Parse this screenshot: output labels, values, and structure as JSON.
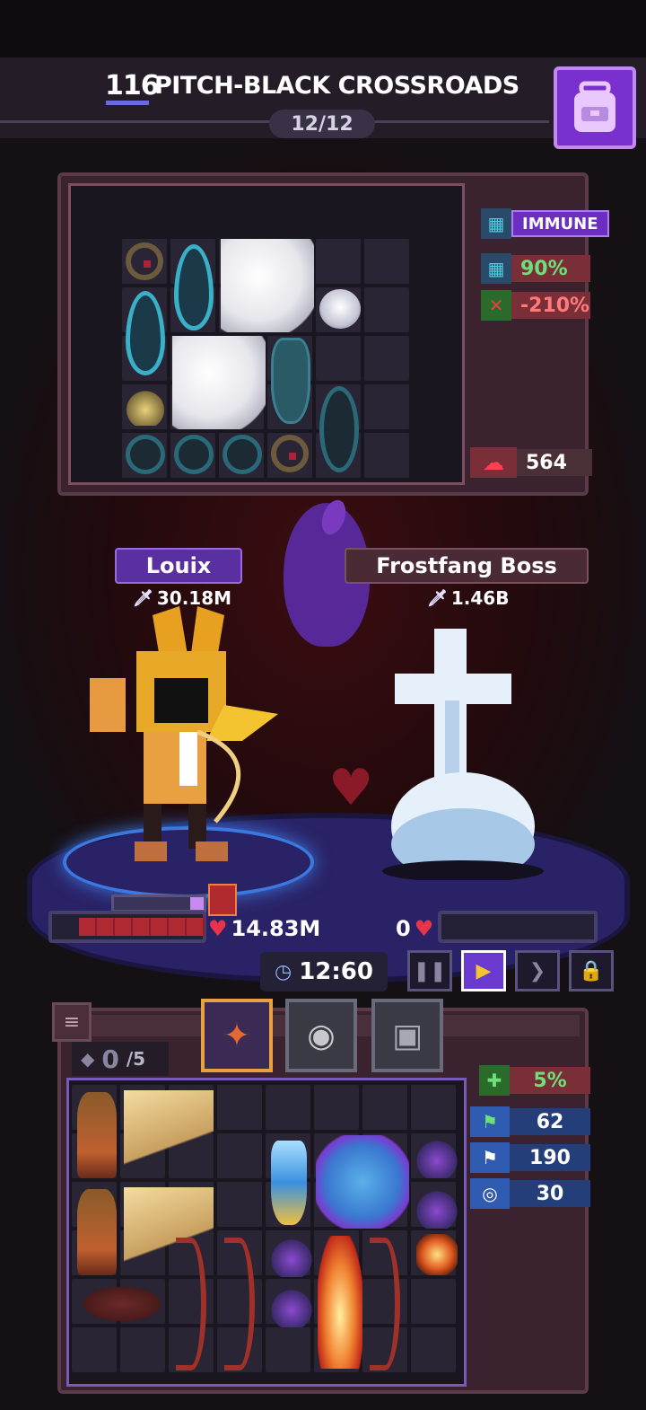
{
  "header": {
    "level": "116",
    "area_name": "PITCH-BLACK CROSSROADS",
    "wave": "12/12"
  },
  "boss_stats": {
    "immune_label": "IMMUNE",
    "resist_value": "90%",
    "debuff_value": "-210%",
    "rage_value": "564"
  },
  "hero": {
    "name": "Louix",
    "power": "30.18M",
    "hp_text": "14.83M",
    "hp_fraction": 1.0,
    "mana_fraction": 0.15
  },
  "boss": {
    "name": "Frostfang Boss",
    "power": "1.46B",
    "hp_text": "0",
    "hp_fraction": 0.0
  },
  "battle": {
    "timer": "12:60"
  },
  "inventory": {
    "count_current": "0",
    "count_total": "/5"
  },
  "hero_stats": {
    "heal_value": "5%",
    "stat1": "62",
    "stat2": "190",
    "stat3": "30"
  },
  "colors": {
    "accent_purple": "#7a2fcf",
    "heal_green": "#3ec04a",
    "stat_blue": "#2f5bb0",
    "debuff_red": "#7a2f38"
  }
}
